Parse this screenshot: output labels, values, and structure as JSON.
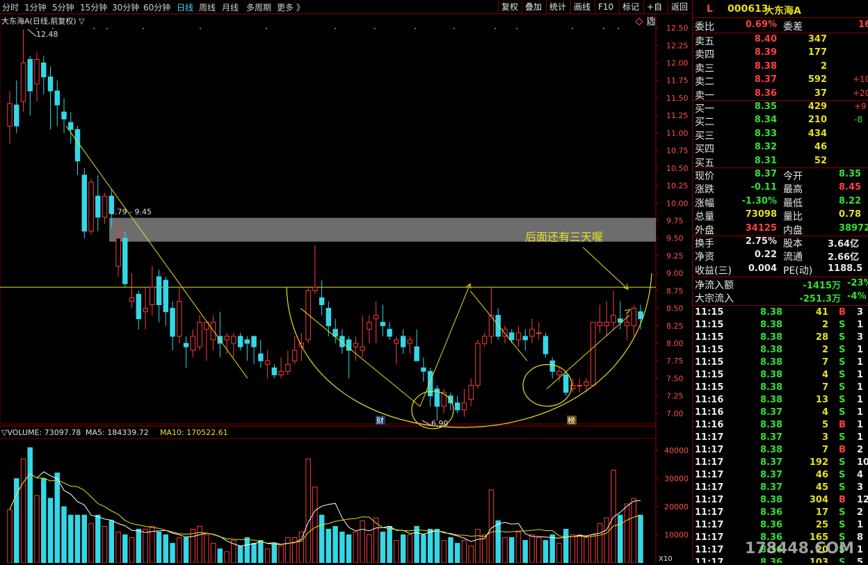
{
  "toolbar": {
    "periods": [
      "分时",
      "1分钟",
      "5分钟",
      "15分钟",
      "30分钟",
      "60分钟",
      "日线",
      "周线",
      "月线",
      "多周期",
      "更多 》"
    ],
    "active_period": "日线",
    "right_buttons": [
      "复权",
      "叠加",
      "统计",
      "画线",
      "F10",
      "标记",
      "+自选",
      "返回"
    ]
  },
  "chart_title": "大东海A(日线,前复权) ▽",
  "price_axis": [
    "12.50",
    "12.25",
    "12.00",
    "11.75",
    "11.50",
    "11.25",
    "11.00",
    "10.75",
    "10.50",
    "10.25",
    "10.00",
    "9.75",
    "9.50",
    "9.25",
    "9.00",
    "8.75",
    "8.50",
    "8.25",
    "8.00",
    "7.75",
    "7.50",
    "7.25",
    "7.00"
  ],
  "annotations": {
    "high_label": "12.48",
    "low_label": "6.90",
    "band_label": "9.79 - 9.45",
    "note": "后面还有三天喔",
    "marker_cai": "财",
    "marker_bang": "榜"
  },
  "volume": {
    "title": "▽VOLUME: 73097.78",
    "ma5": "MA5: 184339.72",
    "ma10": "MA10: 170522.61",
    "axis": [
      "40000",
      "30000",
      "20000",
      "10000"
    ],
    "unit": "X10"
  },
  "colors": {
    "up": "#ff3c3c",
    "down": "#35d7e6",
    "ma": "#e8e020",
    "ma10": "#ffffff",
    "band": "#808080"
  },
  "stock": {
    "flag": "L",
    "code": "000613",
    "name": "大东海A"
  },
  "weibi": {
    "label1": "委比",
    "value1": "0.69%",
    "label2": "委差",
    "value2": "16"
  },
  "asks": [
    {
      "label": "卖五",
      "price": "8.40",
      "vol": "347",
      "chg": ""
    },
    {
      "label": "卖四",
      "price": "8.39",
      "vol": "177",
      "chg": ""
    },
    {
      "label": "卖三",
      "price": "8.38",
      "vol": "2",
      "chg": ""
    },
    {
      "label": "卖二",
      "price": "8.37",
      "vol": "592",
      "chg": "+10"
    },
    {
      "label": "卖一",
      "price": "8.36",
      "vol": "37",
      "chg": "+20"
    }
  ],
  "bids": [
    {
      "label": "买一",
      "price": "8.35",
      "vol": "429",
      "chg": "+9"
    },
    {
      "label": "买二",
      "price": "8.34",
      "vol": "210",
      "chg": "-8"
    },
    {
      "label": "买三",
      "price": "8.33",
      "vol": "434",
      "chg": ""
    },
    {
      "label": "买四",
      "price": "8.32",
      "vol": "46",
      "chg": ""
    },
    {
      "label": "买五",
      "price": "8.31",
      "vol": "52",
      "chg": ""
    }
  ],
  "quote": [
    {
      "l1": "现价",
      "v1": "8.37",
      "c1": "green",
      "l2": "今开",
      "v2": "8.35",
      "c2": "green"
    },
    {
      "l1": "涨跌",
      "v1": "-0.11",
      "c1": "green",
      "l2": "最高",
      "v2": "8.45",
      "c2": "red"
    },
    {
      "l1": "涨幅",
      "v1": "-1.30%",
      "c1": "green",
      "l2": "最低",
      "v2": "8.22",
      "c2": "green"
    },
    {
      "l1": "总量",
      "v1": "73098",
      "c1": "yellow",
      "l2": "量比",
      "v2": "0.78",
      "c2": "yellow"
    },
    {
      "l1": "外盘",
      "v1": "34125",
      "c1": "red",
      "l2": "内盘",
      "v2": "38972",
      "c2": "green"
    }
  ],
  "stats": [
    {
      "l1": "换手",
      "v1": "2.75%",
      "l2": "股本",
      "v2": "3.64亿"
    },
    {
      "l1": "净资",
      "v1": "0.22",
      "l2": "流通",
      "v2": "2.66亿"
    },
    {
      "l1": "收益(三)",
      "v1": "0.004",
      "l2": "PE(动)",
      "v2": "1188.5"
    }
  ],
  "flows": [
    {
      "label": "净流入额",
      "value": "-1415万",
      "pct": "-23%"
    },
    {
      "label": "大宗流入",
      "value": "-251.3万",
      "pct": "-4%"
    }
  ],
  "ticks": [
    {
      "t": "11:15",
      "p": "8.38",
      "v": "41",
      "s": "B",
      "n": "3"
    },
    {
      "t": "11:15",
      "p": "8.38",
      "v": "2",
      "s": "S",
      "n": "1"
    },
    {
      "t": "11:15",
      "p": "8.38",
      "v": "28",
      "s": "S",
      "n": "3"
    },
    {
      "t": "11:15",
      "p": "8.38",
      "v": "2",
      "s": "S",
      "n": "1"
    },
    {
      "t": "11:15",
      "p": "8.38",
      "v": "7",
      "s": "S",
      "n": "1"
    },
    {
      "t": "11:15",
      "p": "8.38",
      "v": "4",
      "s": "S",
      "n": "1"
    },
    {
      "t": "11:15",
      "p": "8.38",
      "v": "7",
      "s": "S",
      "n": "1"
    },
    {
      "t": "11:16",
      "p": "8.38",
      "v": "13",
      "s": "S",
      "n": "1"
    },
    {
      "t": "11:16",
      "p": "8.37",
      "v": "4",
      "s": "S",
      "n": "1"
    },
    {
      "t": "11:16",
      "p": "8.38",
      "v": "5",
      "s": "B",
      "n": "1"
    },
    {
      "t": "11:17",
      "p": "8.37",
      "v": "3",
      "s": "S",
      "n": "1"
    },
    {
      "t": "11:17",
      "p": "8.38",
      "v": "7",
      "s": "B",
      "n": "2"
    },
    {
      "t": "11:17",
      "p": "8.37",
      "v": "192",
      "s": "S",
      "n": "10"
    },
    {
      "t": "11:17",
      "p": "8.37",
      "v": "46",
      "s": "S",
      "n": "4"
    },
    {
      "t": "11:17",
      "p": "8.37",
      "v": "45",
      "s": "S",
      "n": "3"
    },
    {
      "t": "11:17",
      "p": "8.38",
      "v": "304",
      "s": "B",
      "n": "12"
    },
    {
      "t": "11:17",
      "p": "8.36",
      "v": "17",
      "s": "S",
      "n": "2"
    },
    {
      "t": "11:17",
      "p": "8.36",
      "v": "25",
      "s": "S",
      "n": "1"
    },
    {
      "t": "11:17",
      "p": "8.36",
      "v": "165",
      "s": "S",
      "n": "8"
    },
    {
      "t": "11:17",
      "p": "8.36",
      "v": "20",
      "s": "S",
      "n": "1"
    },
    {
      "t": "11:17",
      "p": "8.36",
      "v": "103",
      "s": "S",
      "n": "5"
    }
  ],
  "watermark": "178448.COM",
  "chart_data": {
    "type": "candlestick",
    "price_range": [
      6.85,
      12.6
    ],
    "volume_range": [
      0,
      44000
    ],
    "candles": [
      [
        11.1,
        11.42,
        11.6,
        10.85
      ],
      [
        11.4,
        11.1,
        11.75,
        11.0
      ],
      [
        11.45,
        12.0,
        12.48,
        11.3
      ],
      [
        12.05,
        11.6,
        12.1,
        11.25
      ],
      [
        11.7,
        12.05,
        12.15,
        11.45
      ],
      [
        12.0,
        11.8,
        12.1,
        11.55
      ],
      [
        11.8,
        11.6,
        11.95,
        11.05
      ],
      [
        11.6,
        11.4,
        11.75,
        11.1
      ],
      [
        11.3,
        11.2,
        11.5,
        11.0
      ],
      [
        11.15,
        11.05,
        11.3,
        10.85
      ],
      [
        11.05,
        10.6,
        11.1,
        10.4
      ],
      [
        10.4,
        9.6,
        10.5,
        9.5
      ],
      [
        9.6,
        10.3,
        10.35,
        9.55
      ],
      [
        10.1,
        9.8,
        10.4,
        9.6
      ],
      [
        9.8,
        10.1,
        10.15,
        9.7
      ],
      [
        10.1,
        9.85,
        10.2,
        9.65
      ],
      [
        9.1,
        9.5,
        9.7,
        8.95
      ],
      [
        9.5,
        8.85,
        9.6,
        8.8
      ],
      [
        8.6,
        8.65,
        9.0,
        8.5
      ],
      [
        8.7,
        8.35,
        8.75,
        8.2
      ],
      [
        8.45,
        8.5,
        8.8,
        8.2
      ],
      [
        8.55,
        8.8,
        9.1,
        8.4
      ],
      [
        8.95,
        8.55,
        9.05,
        8.3
      ],
      [
        8.9,
        8.45,
        8.95,
        8.25
      ],
      [
        8.5,
        8.1,
        8.6,
        7.9
      ],
      [
        8.1,
        8.6,
        8.8,
        8.0
      ],
      [
        8.0,
        7.95,
        8.1,
        7.65
      ],
      [
        7.9,
        8.1,
        8.2,
        7.8
      ],
      [
        7.95,
        8.3,
        8.4,
        7.9
      ],
      [
        8.2,
        8.3,
        8.3,
        7.75
      ],
      [
        8.05,
        8.3,
        8.4,
        7.9
      ],
      [
        8.1,
        8.0,
        8.45,
        7.8
      ],
      [
        8.05,
        8.1,
        8.15,
        7.85
      ],
      [
        8.0,
        8.1,
        8.15,
        7.8
      ],
      [
        8.1,
        7.95,
        8.15,
        7.9
      ],
      [
        8.05,
        8.0,
        8.1,
        7.75
      ],
      [
        8.1,
        7.95,
        8.1,
        7.7
      ],
      [
        7.85,
        7.75,
        8.05,
        7.65
      ],
      [
        7.7,
        7.75,
        7.9,
        7.5
      ],
      [
        7.65,
        7.55,
        7.7,
        7.5
      ],
      [
        7.55,
        7.6,
        7.8,
        7.5
      ],
      [
        7.6,
        7.7,
        7.9,
        7.55
      ],
      [
        7.75,
        7.9,
        8.1,
        7.7
      ],
      [
        7.95,
        8.0,
        8.15,
        7.75
      ],
      [
        8.05,
        8.75,
        8.8,
        8.0
      ],
      [
        8.75,
        8.8,
        9.4,
        8.7
      ],
      [
        8.65,
        8.55,
        8.9,
        8.4
      ],
      [
        8.5,
        8.25,
        8.6,
        8.1
      ],
      [
        8.2,
        8.1,
        8.35,
        8.0
      ],
      [
        8.1,
        7.95,
        8.2,
        7.85
      ],
      [
        8.05,
        7.9,
        8.1,
        7.5
      ],
      [
        7.95,
        8.0,
        8.1,
        7.75
      ],
      [
        7.9,
        7.95,
        8.4,
        7.8
      ],
      [
        8.2,
        8.3,
        8.4,
        8.0
      ],
      [
        8.35,
        8.4,
        8.6,
        8.0
      ],
      [
        8.3,
        8.25,
        8.55,
        8.1
      ],
      [
        8.2,
        8.1,
        8.3,
        8.05
      ],
      [
        8.0,
        8.05,
        8.1,
        7.7
      ],
      [
        8.1,
        7.95,
        8.2,
        7.85
      ],
      [
        8.0,
        8.05,
        8.1,
        7.85
      ],
      [
        7.95,
        7.75,
        8.2,
        7.75
      ],
      [
        7.65,
        7.6,
        7.8,
        7.45
      ],
      [
        7.6,
        7.25,
        7.65,
        7.1
      ],
      [
        7.35,
        7.1,
        7.4,
        6.9
      ],
      [
        7.1,
        7.3,
        7.35,
        7.0
      ],
      [
        7.25,
        7.15,
        7.3,
        7.05
      ],
      [
        7.15,
        7.05,
        7.25,
        7.0
      ],
      [
        7.05,
        7.15,
        7.35,
        6.95
      ],
      [
        7.2,
        7.4,
        7.5,
        7.1
      ],
      [
        7.4,
        8.0,
        8.05,
        7.35
      ],
      [
        8.0,
        8.1,
        8.15,
        7.95
      ],
      [
        8.1,
        8.4,
        8.8,
        8.0
      ],
      [
        8.4,
        8.1,
        8.5,
        8.05
      ],
      [
        8.1,
        8.2,
        8.25,
        8.0
      ],
      [
        8.15,
        8.05,
        8.2,
        8.0
      ],
      [
        8.05,
        8.15,
        8.25,
        7.95
      ],
      [
        8.1,
        8.05,
        8.2,
        7.9
      ],
      [
        8.1,
        8.2,
        8.35,
        8.0
      ],
      [
        8.15,
        8.15,
        8.3,
        8.05
      ],
      [
        8.1,
        7.85,
        8.15,
        7.8
      ],
      [
        7.75,
        7.6,
        7.8,
        7.5
      ],
      [
        7.55,
        7.6,
        7.65,
        7.45
      ],
      [
        7.55,
        7.3,
        7.6,
        7.25
      ],
      [
        7.35,
        7.4,
        7.5,
        7.3
      ],
      [
        7.4,
        7.4,
        7.5,
        7.3
      ],
      [
        7.4,
        7.45,
        7.5,
        7.3
      ],
      [
        7.4,
        8.3,
        8.3,
        7.4
      ],
      [
        8.25,
        8.3,
        8.55,
        8.15
      ],
      [
        8.25,
        8.3,
        8.6,
        8.1
      ],
      [
        8.3,
        8.4,
        8.75,
        8.2
      ],
      [
        8.35,
        8.3,
        8.6,
        8.2
      ],
      [
        8.25,
        8.3,
        8.45,
        8.05
      ],
      [
        8.25,
        8.5,
        8.55,
        8.1
      ],
      [
        8.45,
        8.35,
        8.55,
        8.2
      ]
    ],
    "volumes": [
      19000,
      30000,
      37000,
      41000,
      24000,
      30000,
      23000,
      32000,
      20000,
      17000,
      17000,
      17000,
      14000,
      17000,
      13000,
      15000,
      11000,
      10000,
      9000,
      12000,
      12000,
      13000,
      11000,
      10000,
      7000,
      9000,
      9000,
      12000,
      13000,
      10000,
      7000,
      5000,
      4000,
      8000,
      6000,
      9000,
      7000,
      8000,
      5000,
      7000,
      6000,
      9000,
      9000,
      11000,
      37000,
      27000,
      17000,
      12000,
      13000,
      11000,
      10000,
      11000,
      15000,
      10000,
      16000,
      11000,
      13000,
      8000,
      10000,
      10000,
      13000,
      10000,
      12000,
      12000,
      8000,
      9000,
      7000,
      8000,
      6000,
      12000,
      10000,
      26000,
      15000,
      9000,
      9000,
      11000,
      8000,
      10000,
      9000,
      8000,
      10000,
      7000,
      12000,
      10000,
      10000,
      9000,
      10000,
      14000,
      16000,
      33000,
      17000,
      21000,
      23000,
      17000
    ]
  }
}
